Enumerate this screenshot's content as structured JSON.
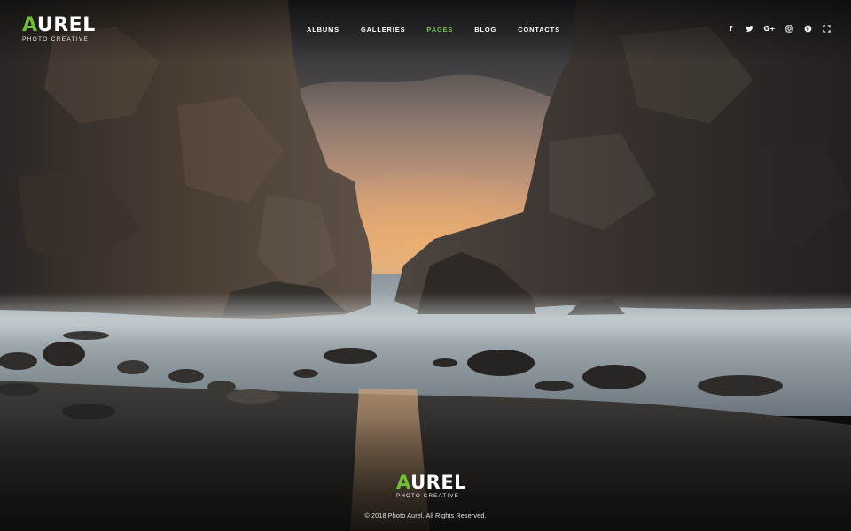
{
  "brand": {
    "first_letter": "A",
    "rest": "UREL",
    "tagline": "PHOTO CREATIVE",
    "accent_color": "#6fbf3b"
  },
  "nav": {
    "items": [
      {
        "label": "ALBUMS",
        "active": false
      },
      {
        "label": "GALLERIES",
        "active": false
      },
      {
        "label": "PAGES",
        "active": true
      },
      {
        "label": "BLOG",
        "active": false
      },
      {
        "label": "CONTACTS",
        "active": false
      }
    ],
    "active_color": "#7cc447"
  },
  "social": {
    "icons": [
      "facebook-icon",
      "twitter-icon",
      "google-plus-icon",
      "instagram-icon",
      "pinterest-icon",
      "fullscreen-icon"
    ]
  },
  "hero": {
    "background": "beach with sea rocks at sunset"
  },
  "footer": {
    "brand_first_letter": "A",
    "brand_rest": "UREL",
    "tagline": "PHOTO CREATIVE",
    "copyright": "© 2018 Photo Aurel. All Rights Reserved."
  }
}
